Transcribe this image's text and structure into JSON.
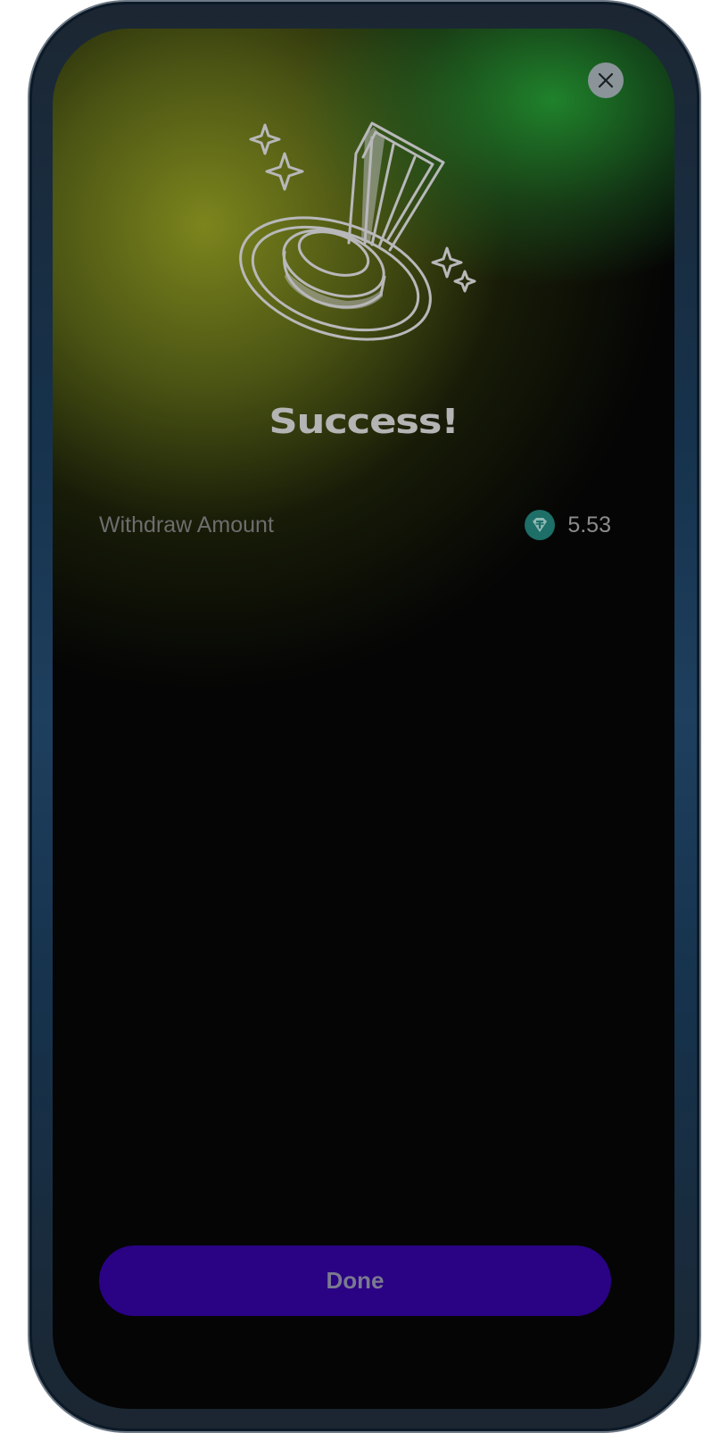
{
  "dialog": {
    "title": "Success!",
    "close_icon": "close-icon",
    "hero_icon": "trophy-pin-icon"
  },
  "details": {
    "label": "Withdraw Amount",
    "token_icon": "tether-usdt-icon",
    "amount": "5.53"
  },
  "actions": {
    "done_label": "Done"
  },
  "colors": {
    "primary_button": "#2a0284",
    "token": "#1d6f68",
    "glow_green": "#229632",
    "glow_olive": "#828c1e"
  }
}
